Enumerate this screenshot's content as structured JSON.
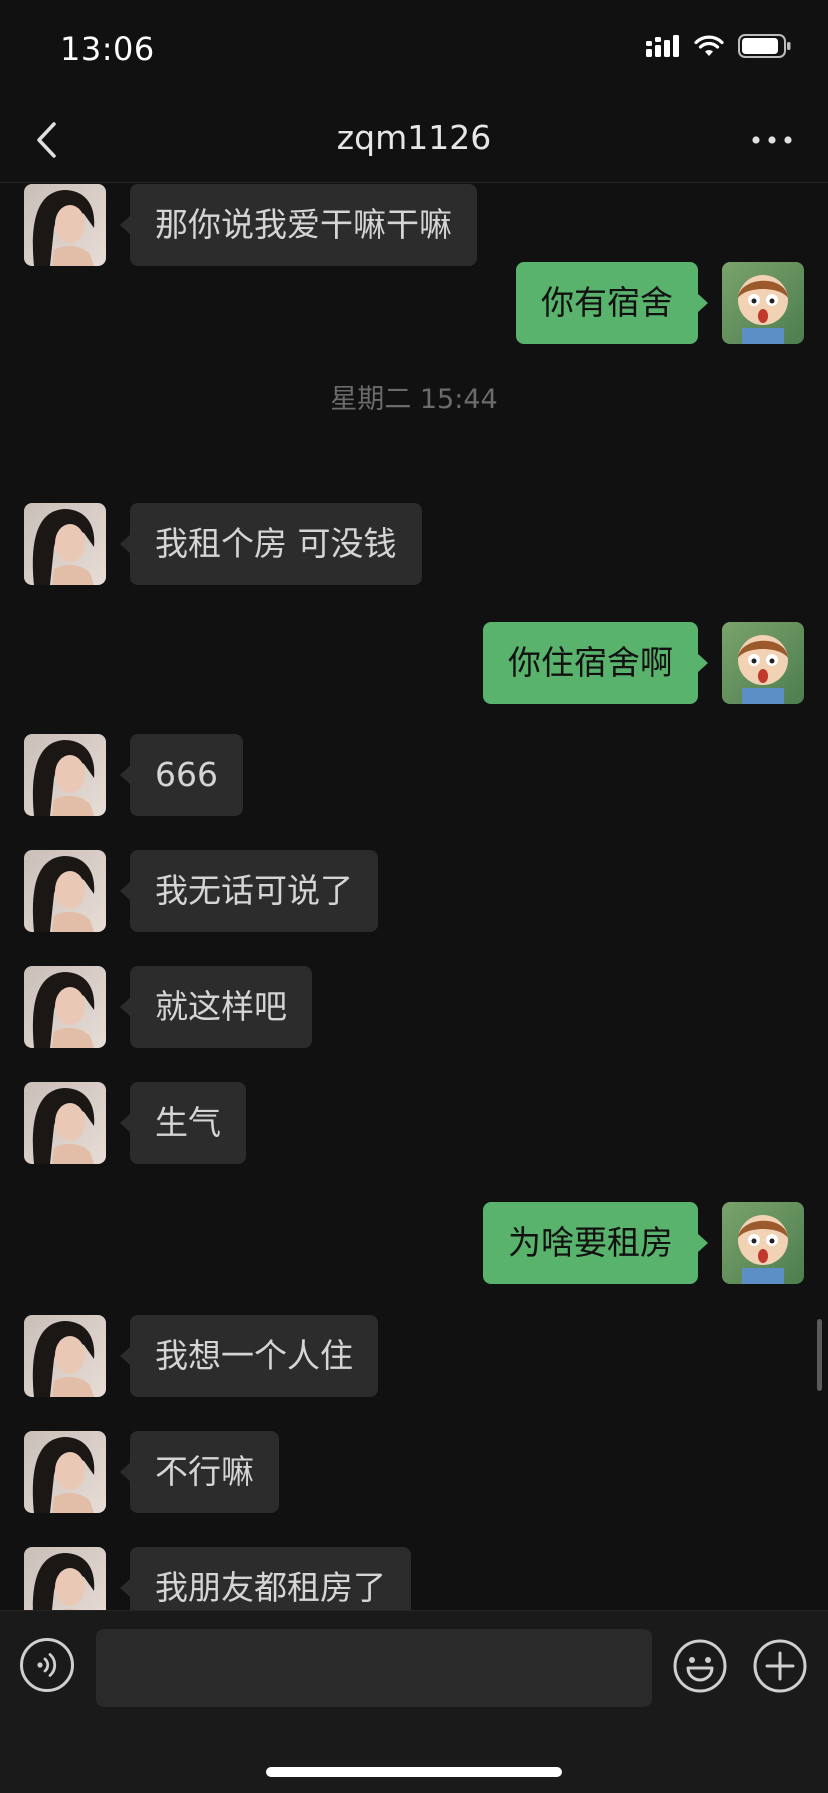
{
  "status_bar": {
    "time": "13:06",
    "icons": [
      "signal-icon",
      "wifi-icon",
      "battery-icon"
    ]
  },
  "nav": {
    "title": "zqm1126",
    "back_icon": "chevron-left-icon",
    "more_icon": "ellipsis-icon"
  },
  "messages": [
    {
      "side": "left",
      "text": "那你说我爱干嘛干嘛"
    },
    {
      "side": "right",
      "text": "你有宿舍"
    },
    {
      "type": "time",
      "text": "星期二 15:44"
    },
    {
      "side": "left",
      "text": "我租个房 可没钱"
    },
    {
      "side": "right",
      "text": "你住宿舍啊"
    },
    {
      "side": "left",
      "text": "666"
    },
    {
      "side": "left",
      "text": "我无话可说了"
    },
    {
      "side": "left",
      "text": "就这样吧"
    },
    {
      "side": "left",
      "text": "生气"
    },
    {
      "side": "right",
      "text": "为啥要租房"
    },
    {
      "side": "left",
      "text": "我想一个人住"
    },
    {
      "side": "left",
      "text": "不行嘛"
    },
    {
      "side": "left",
      "text": "我朋友都租房了"
    }
  ],
  "input_bar": {
    "value": "",
    "icons": [
      "voice-icon",
      "emoji-icon",
      "plus-icon"
    ]
  },
  "colors": {
    "background": "#111111",
    "bubble_received": "#2c2c2c",
    "bubble_sent": "#59b36c"
  }
}
